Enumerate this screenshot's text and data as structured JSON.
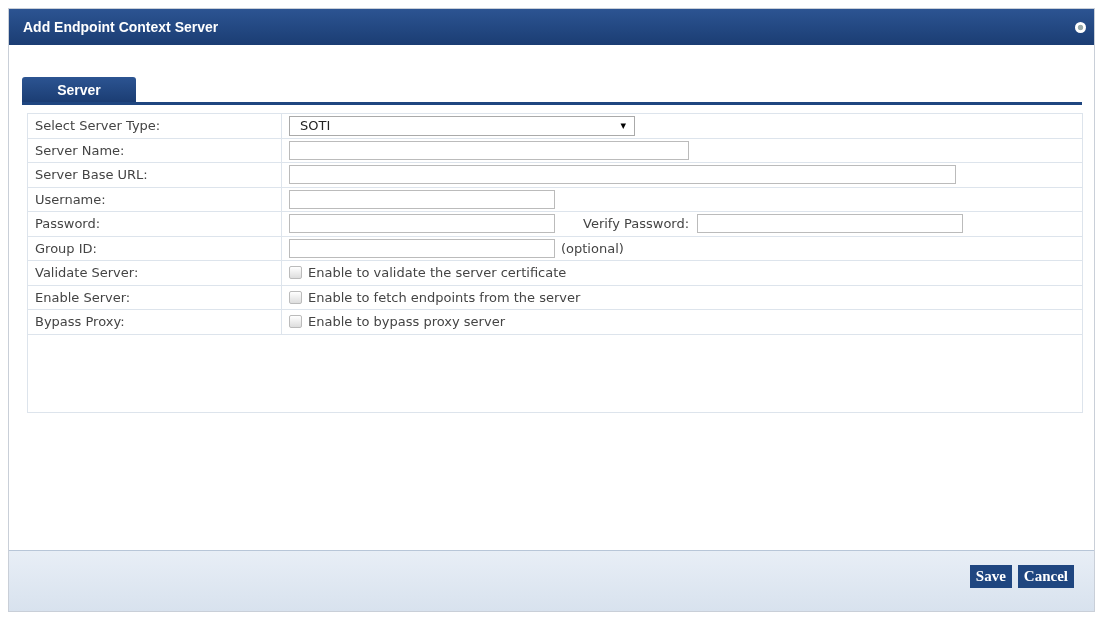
{
  "window": {
    "title": "Add Endpoint Context Server"
  },
  "tabs": [
    {
      "label": "Server",
      "selected": true
    }
  ],
  "rows": [
    {
      "kind": "select",
      "label": "Select Server Type:",
      "value": "SOTI",
      "caret": "▾"
    },
    {
      "kind": "text",
      "label": "Server Name:"
    },
    {
      "kind": "text",
      "label": "Server Base URL:"
    },
    {
      "kind": "text",
      "label": "Username:"
    },
    {
      "kind": "pair",
      "label": "Password:",
      "second_label": "Verify Password:"
    },
    {
      "kind": "text",
      "label": "Group ID:",
      "note": "(optional)"
    },
    {
      "kind": "checkbox",
      "label": "Validate Server:",
      "checked": false,
      "text": "Enable to validate the server certificate"
    },
    {
      "kind": "checkbox",
      "label": "Enable Server:",
      "checked": false,
      "text": "Enable to fetch endpoints from the server"
    },
    {
      "kind": "checkbox",
      "label": "Bypass Proxy:",
      "checked": false,
      "text": "Enable to bypass proxy server"
    }
  ],
  "buttons": [
    "Save",
    "Cancel"
  ]
}
